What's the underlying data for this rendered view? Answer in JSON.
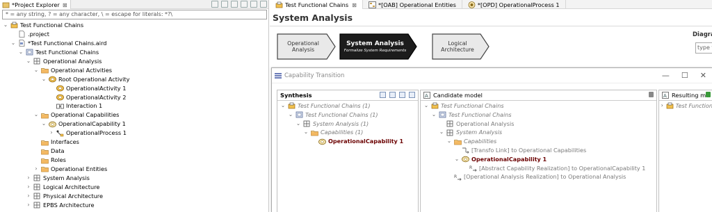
{
  "project_explorer": {
    "tab_label": "*Project Explorer",
    "filter_placeholder": "* = any string, ? = any character, \\ = escape for literals: *?\\",
    "tree": [
      {
        "label": "Test Functional Chains",
        "indent": 0,
        "toggle": "collapse",
        "icon": "project-icon"
      },
      {
        "label": ".project",
        "indent": 1,
        "toggle": "",
        "icon": "file-icon"
      },
      {
        "label": "*Test Functional Chains.aird",
        "indent": 1,
        "toggle": "collapse",
        "icon": "aird-file-icon"
      },
      {
        "label": "Test Functional Chains",
        "indent": 2,
        "toggle": "collapse",
        "icon": "model-icon"
      },
      {
        "label": "Operational Analysis",
        "indent": 3,
        "toggle": "collapse",
        "icon": "layer-icon"
      },
      {
        "label": "Operational Activities",
        "indent": 4,
        "toggle": "collapse",
        "icon": "folder-icon"
      },
      {
        "label": "Root Operational Activity",
        "indent": 5,
        "toggle": "collapse",
        "icon": "activity-icon"
      },
      {
        "label": "OperationalActivity 1",
        "indent": 6,
        "toggle": "",
        "icon": "activity-icon"
      },
      {
        "label": "OperationalActivity 2",
        "indent": 6,
        "toggle": "",
        "icon": "activity-icon"
      },
      {
        "label": "Interaction 1",
        "indent": 6,
        "toggle": "",
        "icon": "interaction-icon"
      },
      {
        "label": "Operational Capabilities",
        "indent": 4,
        "toggle": "collapse",
        "icon": "folder-icon"
      },
      {
        "label": "OperationalCapability 1",
        "indent": 5,
        "toggle": "collapse",
        "icon": "capability-icon"
      },
      {
        "label": "OperationalProcess 1",
        "indent": 6,
        "toggle": "expand",
        "icon": "process-icon"
      },
      {
        "label": "Interfaces",
        "indent": 4,
        "toggle": "",
        "icon": "folder-icon"
      },
      {
        "label": "Data",
        "indent": 4,
        "toggle": "",
        "icon": "folder-icon"
      },
      {
        "label": "Roles",
        "indent": 4,
        "toggle": "",
        "icon": "folder-icon"
      },
      {
        "label": "Operational Entities",
        "indent": 4,
        "toggle": "expand",
        "icon": "folder-icon"
      },
      {
        "label": "System Analysis",
        "indent": 3,
        "toggle": "expand",
        "icon": "layer-icon"
      },
      {
        "label": "Logical Architecture",
        "indent": 3,
        "toggle": "expand",
        "icon": "layer-icon"
      },
      {
        "label": "Physical Architecture",
        "indent": 3,
        "toggle": "expand",
        "icon": "layer-icon"
      },
      {
        "label": "EPBS Architecture",
        "indent": 3,
        "toggle": "expand",
        "icon": "layer-icon"
      }
    ]
  },
  "editor": {
    "tabs": [
      {
        "label": "Test Functional Chains",
        "suffix": "⊠",
        "icon": "project-icon"
      },
      {
        "label": "*[OAB] Operational Entities",
        "suffix": "",
        "icon": "diagram-icon"
      },
      {
        "label": "*[OPD] OperationalProcess 1",
        "suffix": "",
        "icon": "process-diagram-icon"
      }
    ],
    "title": "System Analysis",
    "steps": [
      {
        "l1": "Operational Analysis",
        "l2": ""
      },
      {
        "l1": "System Analysis",
        "l2": "Formalize System Requirements"
      },
      {
        "l1": "Logical Architecture",
        "l2": ""
      }
    ],
    "diagrams_label": "Diagra",
    "diagrams_input": "type t"
  },
  "dialog": {
    "title": "Capability Transition",
    "synthesis": {
      "header": "Synthesis",
      "rows": [
        {
          "label": "Test Functional Chains (1)",
          "indent": 0,
          "toggle": "collapse",
          "icon": "project-icon",
          "style": "it"
        },
        {
          "label": "Test Functional Chains (1)",
          "indent": 1,
          "toggle": "collapse",
          "icon": "model-icon",
          "style": "it"
        },
        {
          "label": "System Analysis (1)",
          "indent": 2,
          "toggle": "collapse",
          "icon": "layer-icon",
          "style": "it"
        },
        {
          "label": "Capabilities (1)",
          "indent": 3,
          "toggle": "collapse",
          "icon": "folder-icon",
          "style": "it"
        },
        {
          "label": "OperationalCapability 1",
          "indent": 4,
          "toggle": "",
          "icon": "capability-icon",
          "style": "bd"
        }
      ]
    },
    "candidate": {
      "header": "Candidate model",
      "rows": [
        {
          "label": "Test Functional Chains",
          "indent": 0,
          "toggle": "collapse",
          "icon": "project-icon",
          "style": "it"
        },
        {
          "label": "Test Functional Chains",
          "indent": 1,
          "toggle": "collapse",
          "icon": "model-icon",
          "style": "it"
        },
        {
          "label": "Operational Analysis",
          "indent": 2,
          "toggle": "",
          "icon": "layer-icon",
          "style": "gray"
        },
        {
          "label": "System Analysis",
          "indent": 2,
          "toggle": "collapse",
          "icon": "layer-icon",
          "style": "it"
        },
        {
          "label": "Capabilities",
          "indent": 3,
          "toggle": "collapse",
          "icon": "folder-icon",
          "style": "it"
        },
        {
          "label": "[Transfo Link] to Operational Capabilities",
          "indent": 4,
          "toggle": "",
          "icon": "link-icon",
          "style": "gray"
        },
        {
          "label": "OperationalCapability 1",
          "indent": 4,
          "toggle": "collapse",
          "icon": "capability-icon",
          "style": "bd"
        },
        {
          "label": "[Abstract Capability Realization] to OperationalCapability 1",
          "indent": 5,
          "toggle": "",
          "icon": "realization-icon",
          "style": "gray"
        },
        {
          "label": "[Operational Analysis Realization] to Operational Analysis",
          "indent": 3,
          "toggle": "",
          "icon": "realization-icon",
          "style": "gray"
        }
      ]
    },
    "resulting": {
      "header": "Resulting m",
      "rows": [
        {
          "label": "Test Function",
          "indent": 0,
          "toggle": "expand",
          "icon": "project-icon",
          "style": "it"
        }
      ]
    }
  },
  "colors": {
    "step_active": "#1c1c1c",
    "step_inactive": "#e9e9e9",
    "selection_text": "#6b0000"
  }
}
